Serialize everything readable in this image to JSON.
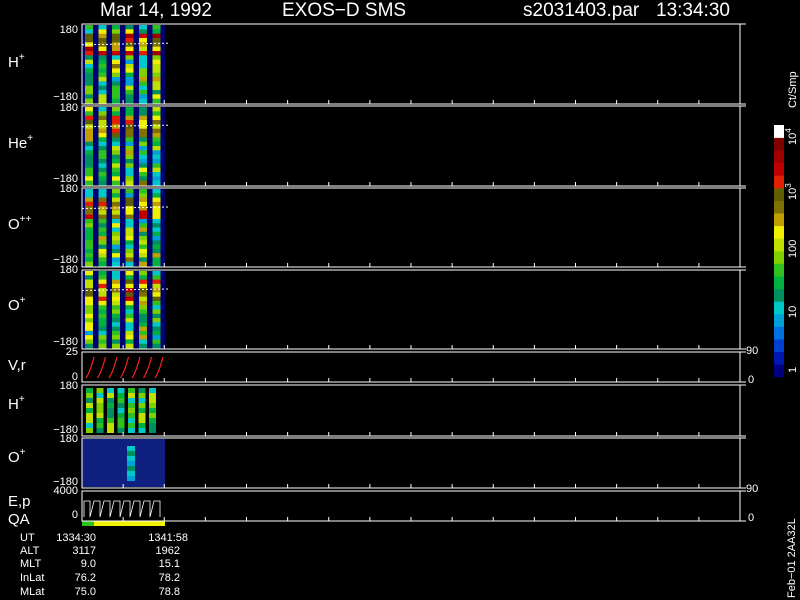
{
  "header": {
    "date": "Mar 14, 1992",
    "instrument": "EXOS−D SMS",
    "file": "s2031403.par",
    "time": "13:34:30"
  },
  "panels": [
    {
      "label": "H",
      "sup": "+",
      "top_tick": "180",
      "bottom_tick": "−180"
    },
    {
      "label": "He",
      "sup": "+",
      "top_tick": "180",
      "bottom_tick": "−180"
    },
    {
      "label": "O",
      "sup": "++",
      "top_tick": "180",
      "bottom_tick": "−180"
    },
    {
      "label": "O",
      "sup": "+",
      "top_tick": "180",
      "bottom_tick": "−180"
    },
    {
      "label": "V,r",
      "sup": "",
      "top_tick": "25",
      "bottom_tick": "0",
      "right_top": "90",
      "right_bottom": "0"
    },
    {
      "label": "H",
      "sup": "+",
      "top_tick": "180",
      "bottom_tick": "−180"
    },
    {
      "label": "O",
      "sup": "+",
      "top_tick": "180",
      "bottom_tick": "−180"
    },
    {
      "label": "E,p",
      "sup": "",
      "top_tick": "4000",
      "bottom_tick": "0",
      "right_top": "90",
      "right_bottom": "0"
    }
  ],
  "qa_label": "QA",
  "colorbar": {
    "unit": "Ct/Smp",
    "ticks": [
      "1",
      "10",
      "100",
      "10",
      "10"
    ],
    "tick_sups": [
      "",
      "",
      "",
      "3",
      "4"
    ],
    "colors": [
      "#000080",
      "#0018b0",
      "#0040d0",
      "#0070e0",
      "#00a0d8",
      "#00c8c8",
      "#009060",
      "#00b040",
      "#30c020",
      "#80d000",
      "#c0e000",
      "#f0f000",
      "#c0a000",
      "#807000",
      "#606000",
      "#e02000",
      "#c00000",
      "#a00000",
      "#800000",
      "#ffffff"
    ]
  },
  "orbit_table": {
    "rows": [
      {
        "label": "UT",
        "start": "1334:30",
        "end": "1341:58"
      },
      {
        "label": "ALT",
        "start": "3117",
        "end": "1962"
      },
      {
        "label": "MLT",
        "start": "9.0",
        "end": "15.1"
      },
      {
        "label": "InLat",
        "start": "76.2",
        "end": "78.2"
      },
      {
        "label": "MLat",
        "start": "75.0",
        "end": "78.8"
      }
    ]
  },
  "version": "Feb−01 2AA32L",
  "chart_data": {
    "type": "heatmap",
    "title": "Mar 14, 1992   EXOS−D SMS",
    "xlabel": "UT",
    "x_range": [
      "1334:30",
      "1341:58"
    ],
    "colorscale": "log",
    "colorscale_range": [
      1,
      10000
    ],
    "series": [
      {
        "name": "H+",
        "ylim": [
          -180,
          180
        ],
        "data_columns": [
          0.0,
          1.0
        ]
      },
      {
        "name": "He+",
        "ylim": [
          -180,
          180
        ],
        "data_columns": [
          0.0,
          1.0
        ]
      },
      {
        "name": "O++",
        "ylim": [
          -180,
          180
        ],
        "data_columns": [
          0.0,
          1.0
        ]
      },
      {
        "name": "O+",
        "ylim": [
          -180,
          180
        ],
        "data_columns": [
          0.0,
          1.0
        ]
      },
      {
        "name": "V,r",
        "ylim": [
          0,
          25
        ],
        "y2lim": [
          0,
          90
        ]
      },
      {
        "name": "H+",
        "ylim": [
          -180,
          180
        ]
      },
      {
        "name": "O+",
        "ylim": [
          -180,
          180
        ]
      },
      {
        "name": "E,p",
        "ylim": [
          0,
          4000
        ],
        "y2lim": [
          0,
          90
        ]
      }
    ]
  }
}
